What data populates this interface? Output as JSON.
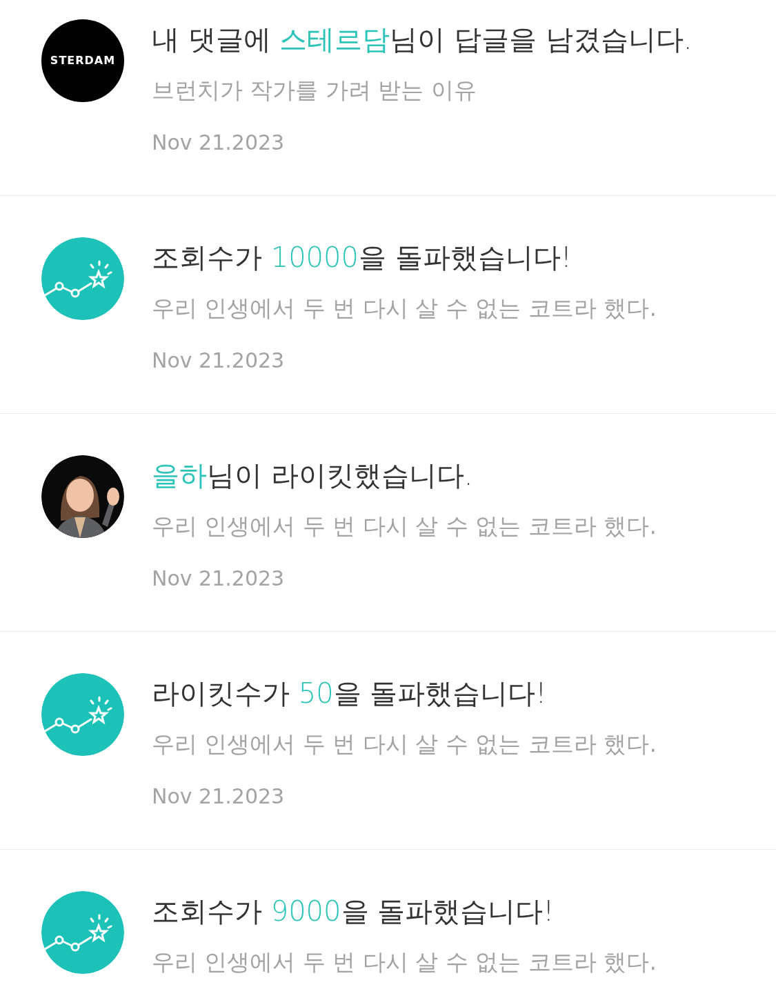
{
  "notifications": [
    {
      "avatar": {
        "kind": "logo",
        "text": "STERDAM"
      },
      "title": [
        {
          "text": "내 댓글에 ",
          "highlight": false
        },
        {
          "text": "스테르담",
          "highlight": true
        },
        {
          "text": "님이 답글을 남겼습니다.",
          "highlight": false
        }
      ],
      "subtitle": "브런치가 작가를 가려 받는 이유",
      "date": "Nov 21.2023"
    },
    {
      "avatar": {
        "kind": "milestone"
      },
      "title": [
        {
          "text": "조회수가 ",
          "highlight": false
        },
        {
          "text": "10000",
          "highlight": true
        },
        {
          "text": "을 돌파했습니다!",
          "highlight": false
        }
      ],
      "subtitle": "우리 인생에서 두 번 다시 살 수 없는 코트라 했다.",
      "date": "Nov 21.2023"
    },
    {
      "avatar": {
        "kind": "picture"
      },
      "title": [
        {
          "text": "을하",
          "highlight": true
        },
        {
          "text": "님이 라이킷했습니다.",
          "highlight": false
        }
      ],
      "subtitle": "우리 인생에서 두 번 다시 살 수 없는 코트라 했다.",
      "date": "Nov 21.2023"
    },
    {
      "avatar": {
        "kind": "milestone"
      },
      "title": [
        {
          "text": "라이킷수가 ",
          "highlight": false
        },
        {
          "text": "50",
          "highlight": true
        },
        {
          "text": "을 돌파했습니다!",
          "highlight": false
        }
      ],
      "subtitle": "우리 인생에서 두 번 다시 살 수 없는 코트라 했다.",
      "date": "Nov 21.2023"
    },
    {
      "avatar": {
        "kind": "milestone"
      },
      "title": [
        {
          "text": "조회수가 ",
          "highlight": false
        },
        {
          "text": "9000",
          "highlight": true
        },
        {
          "text": "을 돌파했습니다!",
          "highlight": false
        }
      ],
      "subtitle": "우리 인생에서 두 번 다시 살 수 없는 코트라 했다."
    }
  ]
}
